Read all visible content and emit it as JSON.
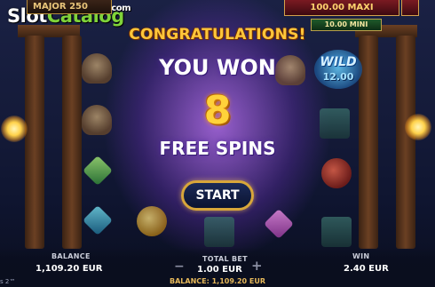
{
  "logo": {
    "slot": "Slot",
    "catalog": "Catalog",
    "com": ".com"
  },
  "jackpots": {
    "major": "MAJOR 250",
    "maxi": "100.00 MAXI",
    "mini": "10.00 MINI"
  },
  "wild": {
    "label": "WILD",
    "amount": "12.00"
  },
  "popup": {
    "congrats": "CONGRATULATIONS!",
    "you_won": "YOU WON",
    "count": "8",
    "free_spins": "FREE SPINS",
    "start_label": "START"
  },
  "stats": {
    "balance_label": "BALANCE",
    "balance_value": "1,109.20 EUR",
    "bet_label": "TOTAL BET",
    "bet_value": "1.00 EUR",
    "win_label": "WIN",
    "win_value": "2.40 EUR",
    "minus": "−",
    "plus": "+"
  },
  "footer": {
    "balance": "BALANCE: 1,109.20 EUR",
    "corner": "s 2™"
  },
  "colors": {
    "accent_gold": "#ffc63a",
    "logo_green": "#7fd33a",
    "button_border": "#d8a63a"
  },
  "icons": [
    "helmet-icon",
    "blue-gem-icon",
    "green-gem-icon",
    "pink-gem-icon",
    "chest-icon",
    "horn-icon",
    "coin-icon",
    "wild-shield-icon",
    "torch-icon"
  ]
}
